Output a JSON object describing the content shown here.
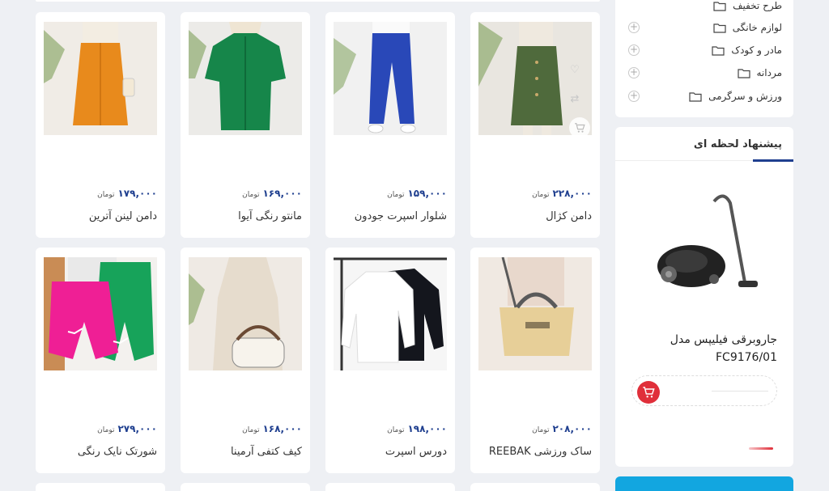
{
  "currency": "تومان",
  "products": [
    {
      "title": "دامن کژال",
      "price": "۲۲۸,۰۰۰"
    },
    {
      "title": "شلوار اسپرت جودون",
      "price": "۱۵۹,۰۰۰"
    },
    {
      "title": "مانتو رنگی آیوا",
      "price": "۱۶۹,۰۰۰"
    },
    {
      "title": "دامن لینن آترین",
      "price": "۱۷۹,۰۰۰"
    },
    {
      "title": "ساک ورزشی REEBAK",
      "price": "۲۰۸,۰۰۰"
    },
    {
      "title": "دورس اسپرت",
      "price": "۱۹۸,۰۰۰"
    },
    {
      "title": "کیف کتفی آرمینا",
      "price": "۱۶۸,۰۰۰"
    },
    {
      "title": "شورتک نایک رنگی",
      "price": "۲۷۹,۰۰۰"
    }
  ],
  "categories": [
    {
      "label": "طرح تخفیف",
      "expandable": false
    },
    {
      "label": "لوازم خانگی",
      "expandable": true
    },
    {
      "label": "مادر و کودک",
      "expandable": true
    },
    {
      "label": "مردانه",
      "expandable": true
    },
    {
      "label": "ورزش و سرگرمی",
      "expandable": true
    }
  ],
  "suggestion": {
    "heading": "پیشنهاد لحظه ای",
    "product_title": "جاروبرقی فیلیپس مدل FC9176/01"
  },
  "colors": {
    "price": "#1f3f8f",
    "cart_button": "#e02f3a",
    "accent_bar": "#12a6e0"
  },
  "icons": [
    "heart-icon",
    "compare-icon",
    "cart-icon",
    "folder-icon",
    "plus-circle-icon"
  ]
}
